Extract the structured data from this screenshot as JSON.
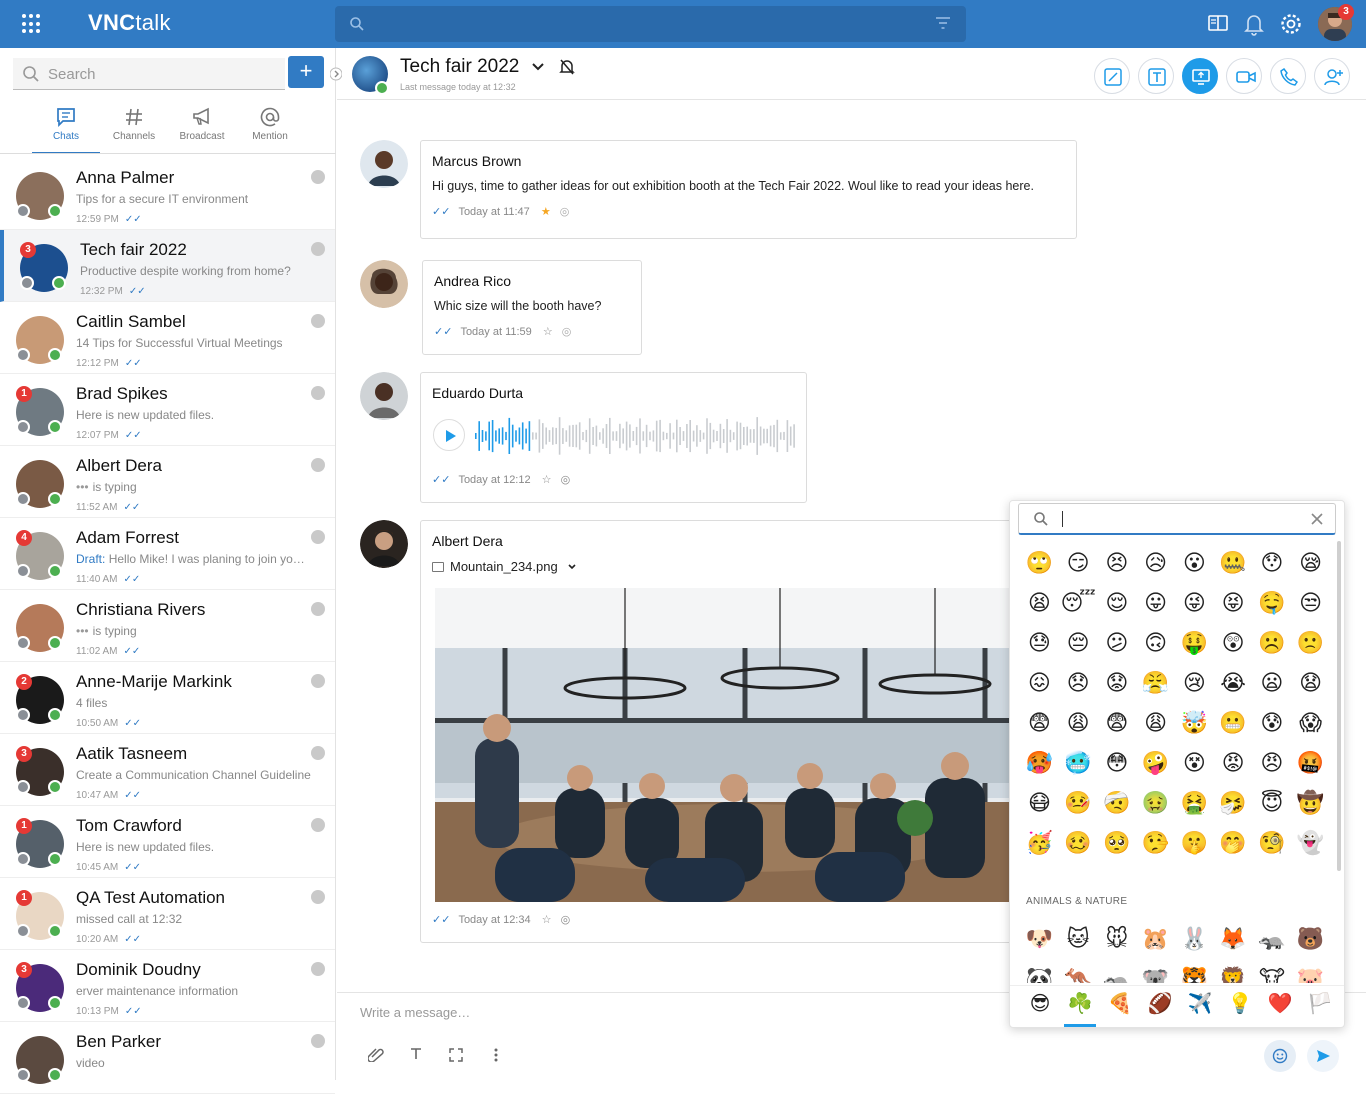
{
  "app": {
    "logo_bold": "VNC",
    "logo_light": "talk",
    "notification_count": "3"
  },
  "sidebar": {
    "search_placeholder": "Search",
    "add_label": "+",
    "tabs": [
      {
        "label": "Chats",
        "icon": "chat-icon"
      },
      {
        "label": "Channels",
        "icon": "hash-icon"
      },
      {
        "label": "Broadcast",
        "icon": "megaphone-icon"
      },
      {
        "label": "Mention",
        "icon": "at-icon"
      }
    ],
    "chats": [
      {
        "name": "Anna Palmer",
        "preview": "Tips for a secure IT environment",
        "time": "12:59 PM",
        "badge": "",
        "color": "#8b6f5c"
      },
      {
        "name": "Tech fair 2022",
        "preview": "Productive despite working from home?",
        "time": "12:32 PM",
        "badge": "3",
        "color": "#1c4f8f"
      },
      {
        "name": "Caitlin Sambel",
        "preview": "14 Tips for Successful Virtual Meetings",
        "time": "12:12 PM",
        "badge": "",
        "color": "#c89a76"
      },
      {
        "name": "Brad Spikes",
        "preview": "Here is new updated files.",
        "time": "12:07 PM",
        "badge": "1",
        "color": "#6f7a82"
      },
      {
        "name": "Albert Dera",
        "preview": "is typing",
        "time": "11:52 AM",
        "badge": "",
        "color": "#7a5a45"
      },
      {
        "name": "Adam Forrest",
        "preview_prefix": "Draft:",
        "preview": "Hello Mike! I was planing to join yo…",
        "time": "11:40 AM",
        "badge": "4",
        "color": "#a8a49c"
      },
      {
        "name": "Christiana Rivers",
        "preview": "is typing",
        "time": "11:02 AM",
        "badge": "",
        "color": "#b57a5a"
      },
      {
        "name": "Anne-Marije Markink",
        "preview": "4 files",
        "time": "10:50 AM",
        "badge": "2",
        "color": "#1a1a1a"
      },
      {
        "name": "Aatik Tasneem",
        "preview": "Create a Communication Channel Guideline",
        "time": "10:47 AM",
        "badge": "3",
        "color": "#3a2f2a"
      },
      {
        "name": "Tom Crawford",
        "preview": "Here is new updated files.",
        "time": "10:45 AM",
        "badge": "1",
        "color": "#55606a"
      },
      {
        "name": "QA Test Automation",
        "preview": "missed call at 12:32",
        "time": "10:20 AM",
        "badge": "1",
        "color": "#e9d7c4"
      },
      {
        "name": "Dominik Doudny",
        "preview": "erver maintenance information",
        "time": "10:13 PM",
        "badge": "3",
        "color": "#4b2a7a"
      },
      {
        "name": "Ben Parker",
        "preview": "video",
        "time": "",
        "badge": "",
        "color": "#5b4a40"
      }
    ]
  },
  "header": {
    "title": "Tech fair 2022",
    "subtitle": "Last message today at 12:32"
  },
  "messages": [
    {
      "author": "Marcus Brown",
      "text": "Hi guys, time to gather ideas for out exhibition booth at the Tech Fair 2022. Woul like to read your ideas here.",
      "time": "Today at 11:47"
    },
    {
      "author": "Andrea Rico",
      "text": "Whic size will the booth have?",
      "time": "Today at 11:59"
    },
    {
      "author": "Eduardo Durta",
      "text": "",
      "time": "Today at 12:12"
    },
    {
      "author": "Albert Dera",
      "file": "Mountain_234.png",
      "time": "Today at 12:34"
    }
  ],
  "audio": {
    "played_fraction": 0.17
  },
  "composer": {
    "placeholder": "Write a message…"
  },
  "emoji_picker": {
    "category_label": "ANIMALS & NATURE",
    "smileys": [
      [
        "🙄",
        "😏",
        "😣",
        "😥",
        "😮",
        "🤐",
        "😯",
        "😪"
      ],
      [
        "😫",
        "😴",
        "😌",
        "😛",
        "😜",
        "😝",
        "🤤",
        "😒"
      ],
      [
        "😓",
        "😔",
        "😕",
        "🙃",
        "🤑",
        "😲",
        "☹️",
        "🙁"
      ],
      [
        "😖",
        "😞",
        "😟",
        "😤",
        "😢",
        "😭",
        "😦",
        "😧"
      ],
      [
        "😨",
        "😩",
        "😨",
        "😩",
        "🤯",
        "😬",
        "😰",
        "😱"
      ],
      [
        "🥵",
        "🥶",
        "😳",
        "🤪",
        "😵",
        "😡",
        "😠",
        "🤬"
      ],
      [
        "😷",
        "🤒",
        "🤕",
        "🤢",
        "🤮",
        "🤧",
        "😇",
        "🤠"
      ],
      [
        "🥳",
        "🥴",
        "🥺",
        "🤥",
        "🤫",
        "🤭",
        "🧐",
        "👻"
      ]
    ],
    "animals": [
      [
        "🐶",
        "🐱",
        "🐭",
        "🐹",
        "🐰",
        "🦊",
        "🦡",
        "🐻"
      ],
      [
        "🐼",
        "🦘",
        "🦡",
        "🐨",
        "🐯",
        "🦁",
        "🐮",
        "🐷"
      ]
    ],
    "categories": [
      "😎",
      "☘️",
      "🍕",
      "🏈",
      "✈️",
      "💡",
      "❤️",
      "🏳️"
    ]
  }
}
